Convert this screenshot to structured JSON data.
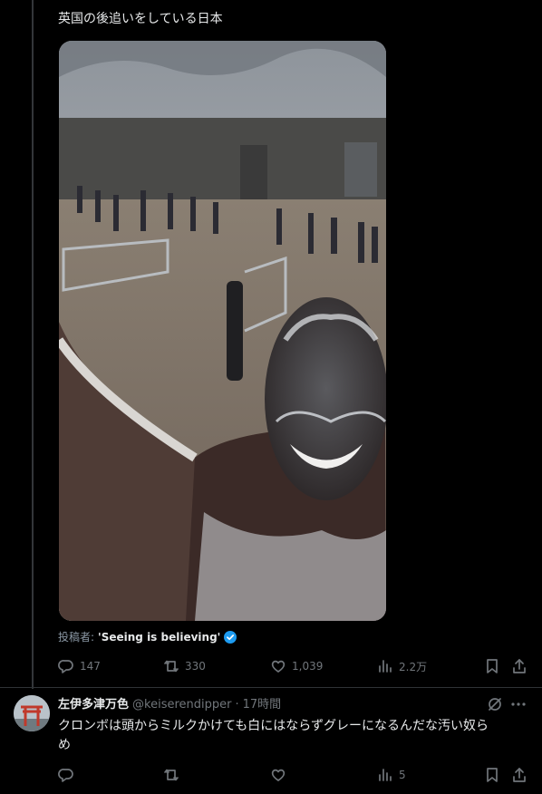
{
  "main_tweet": {
    "text": "英国の後追いをしている日本",
    "media_alt": "video still",
    "attribution_prefix": "投稿者:",
    "attribution_name": "'Seeing is believing'",
    "stats": {
      "replies": "147",
      "retweets": "330",
      "likes": "1,039",
      "views": "2.2万"
    }
  },
  "reply": {
    "name": "左伊多津万色",
    "handle": "@keiserendipper",
    "dot": "·",
    "time": "17時間",
    "body": "クロンボは頭からミルクかけても白にはならずグレーになるんだな汚い奴らめ",
    "stats": {
      "views": "5"
    }
  },
  "colors": {
    "background": "#000000",
    "text": "#e7e9ea",
    "muted": "#71767b",
    "verified": "#1d9bf0",
    "divider": "#2f3336"
  },
  "icons": {
    "reply": "reply-icon",
    "retweet": "retweet-icon",
    "like": "heart-icon",
    "views": "views-icon",
    "bookmark": "bookmark-icon",
    "share": "share-icon",
    "grok": "grok-icon",
    "more": "more-icon",
    "verified": "verified-badge-icon"
  }
}
